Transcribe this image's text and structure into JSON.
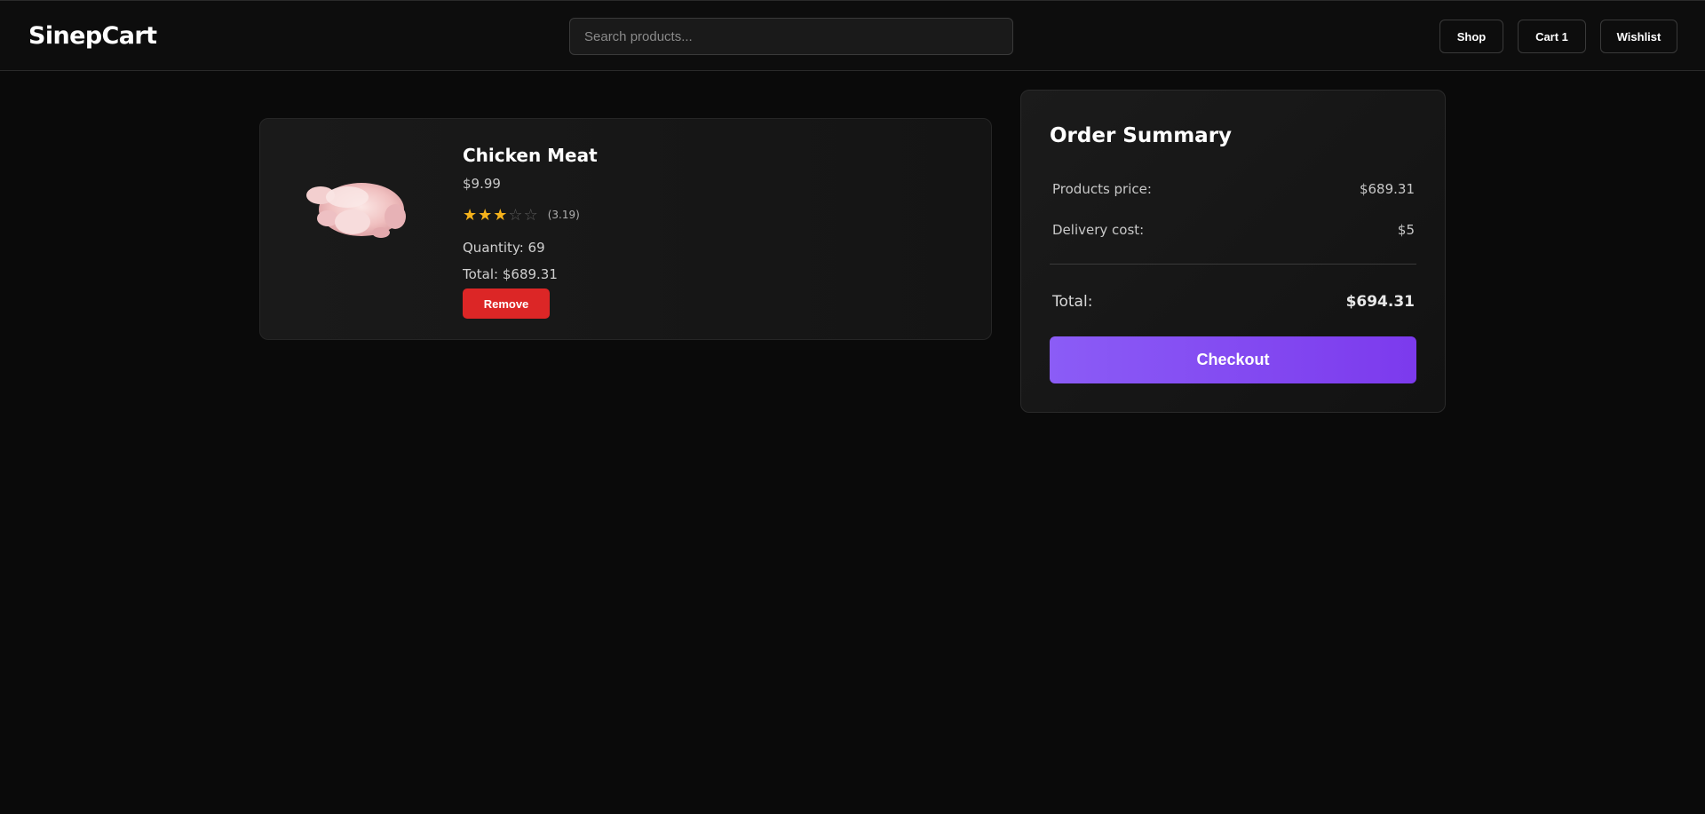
{
  "header": {
    "logo": "SinepCart",
    "search_placeholder": "Search products...",
    "nav": {
      "shop": "Shop",
      "cart": "Cart 1",
      "wishlist": "Wishlist"
    }
  },
  "cart": {
    "items": [
      {
        "name": "Chicken Meat",
        "price": "$9.99",
        "rating": 3.19,
        "rating_text": "(3.19)",
        "stars": [
          "star-filled",
          "star-filled",
          "star-filled",
          "star-empty",
          "star-empty"
        ],
        "quantity_text": "Quantity: 69",
        "total_text": "Total: $689.31",
        "remove_label": "Remove",
        "image_icon": "raw-chicken-image"
      }
    ]
  },
  "summary": {
    "title": "Order Summary",
    "products_price_label": "Products price:",
    "products_price_value": "$689.31",
    "delivery_label": "Delivery cost:",
    "delivery_value": "$5",
    "total_label": "Total:",
    "total_value": "$694.31",
    "checkout_label": "Checkout"
  },
  "colors": {
    "background": "#0a0a0a",
    "star_filled": "#f5b21b",
    "remove_button": "#dc2626",
    "checkout_gradient_start": "#8b5cf6",
    "checkout_gradient_end": "#7c3aed"
  }
}
